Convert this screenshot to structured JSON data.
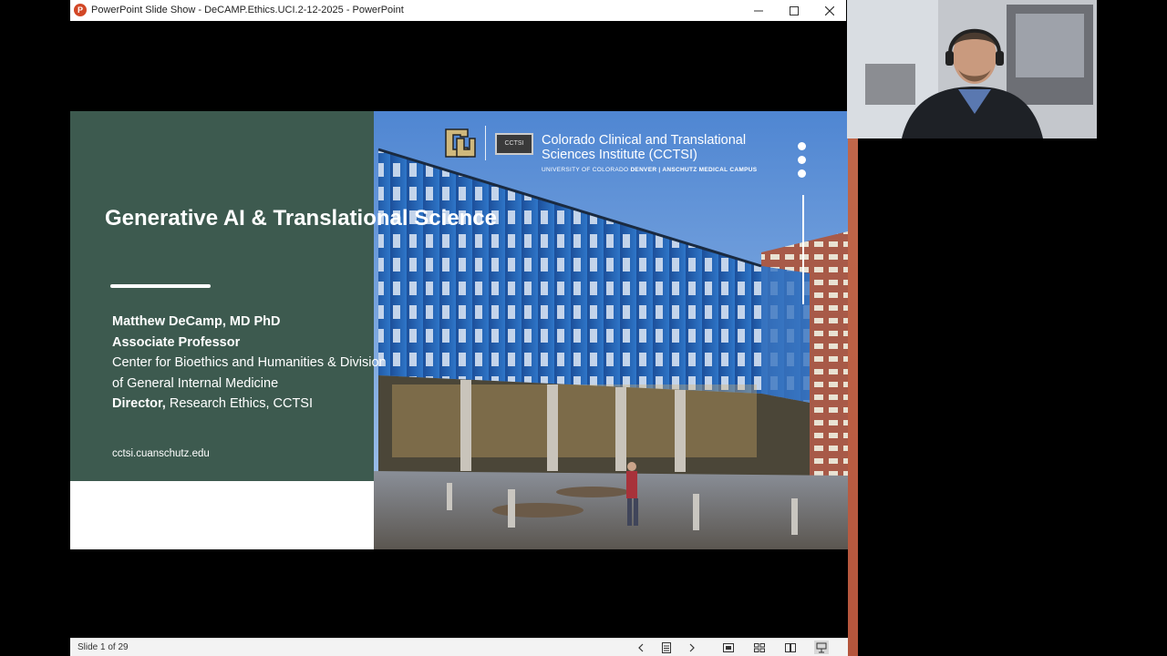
{
  "window": {
    "title": "PowerPoint Slide Show  -  DeCAMP.Ethics.UCI.2-12-2025  -  PowerPoint",
    "app_icon_letter": "P"
  },
  "slide": {
    "title": "Generative AI & Translational Science",
    "presenter": {
      "name": "Matthew DeCamp, MD PhD",
      "position": "Associate Professor",
      "dept_line1": "Center for Bioethics and Humanities & Division",
      "dept_line2": "of General Internal Medicine",
      "director_label": "Director,",
      "director_role": "Research Ethics, CCTSI"
    },
    "website": "cctsi.cuanschutz.edu",
    "institute": {
      "name_line1": "Colorado Clinical and Translational",
      "name_line2": "Sciences Institute (CCTSI)",
      "sub_left": "UNIVERSITY OF COLORADO ",
      "sub_bold": "DENVER | ANSCHUTZ MEDICAL CAMPUS",
      "badge": "CCTSI"
    }
  },
  "statusbar": {
    "slide_indicator": "Slide 1 of 29"
  },
  "colors": {
    "panel_green": "#3d5a4f",
    "building_blue": "#1f63b8",
    "brick": "#a85a48"
  }
}
